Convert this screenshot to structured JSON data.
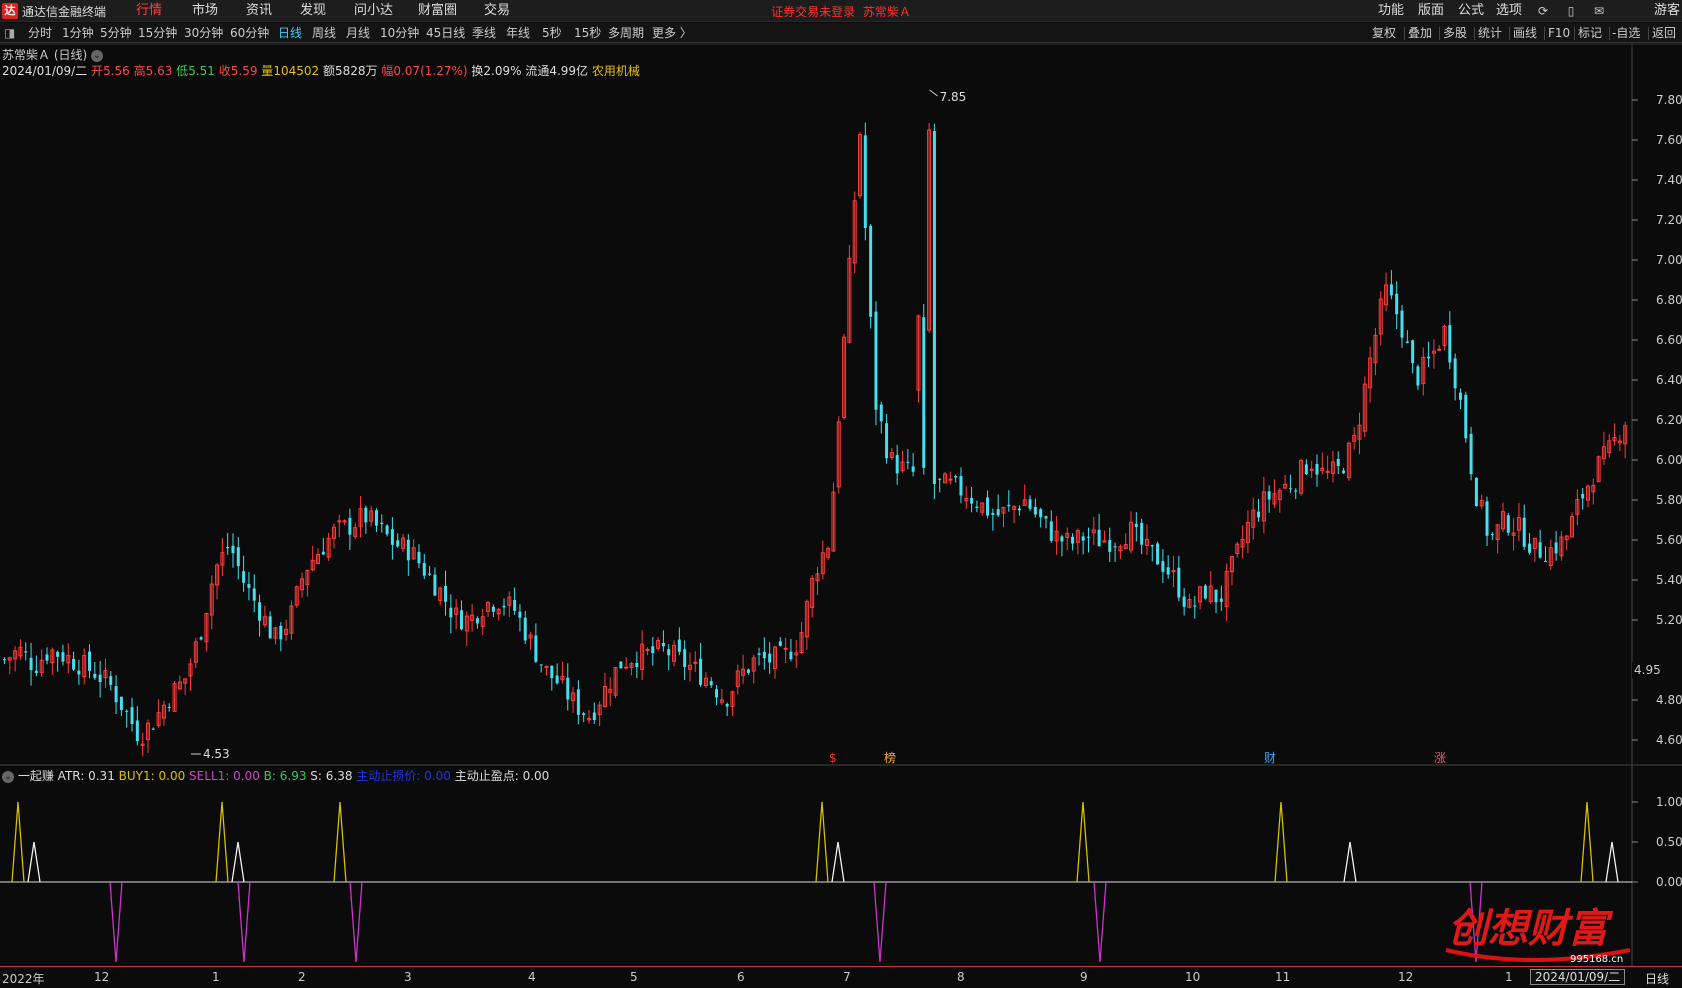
{
  "app": {
    "logo_char": "达",
    "name": "通达信金融终端",
    "menus": [
      "行情",
      "市场",
      "资讯",
      "发现",
      "问小达",
      "财富圈",
      "交易"
    ],
    "active_menu": "行情",
    "notice": "证券交易未登录",
    "notice_stock": "苏常柴Ａ",
    "right_menus": [
      "功能",
      "版面",
      "公式",
      "选项"
    ],
    "guest": "游客"
  },
  "periods": [
    "分时",
    "1分钟",
    "5分钟",
    "15分钟",
    "30分钟",
    "60分钟",
    "日线",
    "周线",
    "月线",
    "10分钟",
    "45日线",
    "季线",
    "年线",
    "5秒",
    "15秒",
    "多周期",
    "更多 〉"
  ],
  "active_period": "日线",
  "tools": [
    "复权",
    "叠加",
    "多股",
    "统计",
    "画线",
    "F10",
    "标记",
    "-自选",
    "返回"
  ],
  "stock": {
    "title": "苏常柴Ａ (日线)",
    "date": "2024/01/09/二",
    "open_label": "开",
    "open": "5.56",
    "high_label": "高",
    "high": "5.63",
    "low_label": "低",
    "low": "5.51",
    "close_label": "收",
    "close": "5.59",
    "vol_label": "量",
    "vol": "104502",
    "amt": "额5828万",
    "chg_label": "幅",
    "chg": "0.07(1.27%)",
    "turnover": "换2.09%",
    "float": "流通4.99亿",
    "sector": "农用机械"
  },
  "indicator": {
    "name": "一起赚",
    "atr": "ATR: 0.31",
    "buy1": "BUY1: 0.00",
    "sell1": "SELL1: 0.00",
    "b": "B: 6.93",
    "s": "S: 6.38",
    "stop_loss": "主动止损价: 0.00",
    "take_profit": "主动止盈点: 0.00"
  },
  "price_axis": {
    "ticks": [
      "7.80",
      "7.60",
      "7.40",
      "7.20",
      "7.00",
      "6.80",
      "6.60",
      "6.40",
      "6.20",
      "6.00",
      "5.80",
      "5.60",
      "5.40",
      "5.20",
      "4.80",
      "4.60"
    ],
    "current": "4.95"
  },
  "ind_axis": {
    "ticks": [
      "1.00",
      "0.50",
      "0.00"
    ]
  },
  "annotations": {
    "high": "7.85",
    "low": "4.53"
  },
  "event_markers": [
    {
      "text": "$",
      "color": "#ff3030"
    },
    {
      "text": "榜",
      "color": "#ffaa33"
    },
    {
      "text": "财",
      "color": "#33aaff"
    },
    {
      "text": "涨",
      "color": "#ff5555"
    }
  ],
  "x_axis": {
    "labels": [
      "2022年",
      "12",
      "1",
      "2",
      "3",
      "4",
      "5",
      "6",
      "7",
      "8",
      "9",
      "10",
      "11",
      "12",
      "1"
    ],
    "cursor_date": "2024/01/09/二",
    "period": "日线"
  },
  "watermark": {
    "text": "创想财富",
    "site": "995168.cn"
  },
  "colors": {
    "up": "#ff3b3b",
    "down": "#44e0ee",
    "bg": "#0b0b0b",
    "active": "#ff4040",
    "buy_line": "#d4c000",
    "sell_line": "#cc33cc"
  },
  "chart_data": {
    "type": "candlestick",
    "ylim": [
      4.5,
      7.9
    ],
    "close_path": [
      5.0,
      5.05,
      4.97,
      5.05,
      5.02,
      4.98,
      4.94,
      4.88,
      4.75,
      4.62,
      4.7,
      4.82,
      4.9,
      5.12,
      5.45,
      5.58,
      5.38,
      5.25,
      5.1,
      5.2,
      5.45,
      5.55,
      5.64,
      5.67,
      5.72,
      5.65,
      5.58,
      5.55,
      5.45,
      5.35,
      5.22,
      5.2,
      5.28,
      5.3,
      5.25,
      5.1,
      4.95,
      4.88,
      4.78,
      4.72,
      4.85,
      4.98,
      5.02,
      5.03,
      5.05,
      5.0,
      4.95,
      4.9,
      4.8,
      4.92,
      5.0,
      5.0,
      5.02,
      5.1,
      5.45,
      5.6,
      6.65,
      7.65,
      6.3,
      6.0,
      5.95,
      5.92,
      5.88,
      5.87,
      5.84,
      5.78,
      5.72,
      5.75,
      5.8,
      5.7,
      5.62,
      5.58,
      5.62,
      5.6,
      5.6,
      5.65,
      5.55,
      5.5,
      5.4,
      5.25,
      5.35,
      5.3,
      5.5,
      5.7,
      5.8,
      5.85,
      5.9,
      6.0,
      5.92,
      5.95,
      6.1,
      6.5,
      6.85,
      6.7,
      6.4,
      6.5,
      6.65,
      6.3,
      5.85,
      5.6,
      5.7,
      5.65,
      5.55,
      5.55,
      5.6,
      5.8,
      5.95,
      6.05,
      6.2
    ],
    "high": 7.85,
    "low": 4.53,
    "indicator": {
      "buy_peaks": [
        1.0,
        1.0,
        1.0,
        1.0,
        1.0,
        1.0,
        1.0
      ],
      "white_peaks": [
        0.5,
        0.5,
        0.5,
        0.5,
        0.5
      ],
      "sell_troughs": [
        -1.0,
        -1.0,
        -1.0,
        -1.0,
        -1.0,
        -1.0
      ],
      "ylim": [
        -1.0,
        1.2
      ]
    }
  }
}
